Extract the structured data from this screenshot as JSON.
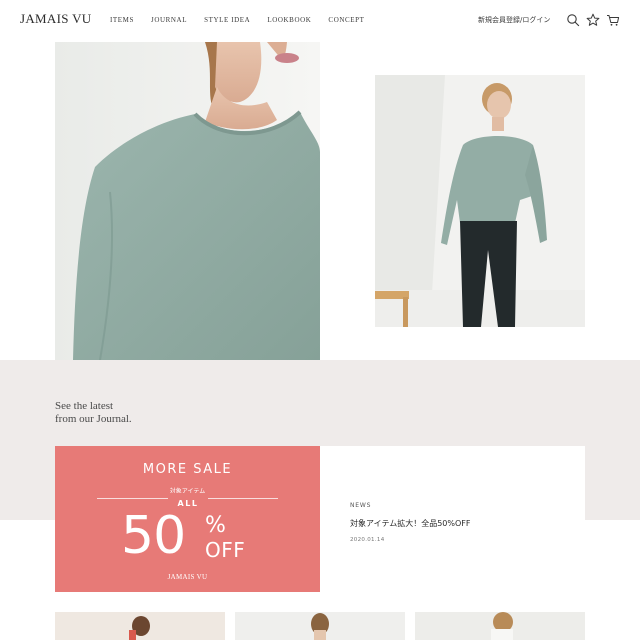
{
  "header": {
    "logo": "JAMAIS VU",
    "nav": [
      "ITEMS",
      "JOURNAL",
      "STYLE IDEA",
      "LOOKBOOK",
      "CONCEPT"
    ],
    "member_link": "新規会員登録/ログイン",
    "icons": [
      "search-icon",
      "star-icon",
      "cart-icon"
    ]
  },
  "journal": {
    "heading_line1": "See the latest",
    "heading_line2": "from our Journal."
  },
  "card": {
    "sale_title": "MORE SALE",
    "sale_sub": "対象アイテム",
    "sale_all": "ALL",
    "sale_number": "50",
    "sale_percent": "%",
    "sale_off": "OFF",
    "sale_brand": "JAMAIS VU",
    "news_label": "NEWS",
    "news_title": "対象アイテム拡大！全品50%OFF",
    "news_date": "2020.01.14"
  },
  "colors": {
    "sale_bg": "#e77a77",
    "band_bg": "#efebea",
    "sweater": "#8fa9a1"
  }
}
